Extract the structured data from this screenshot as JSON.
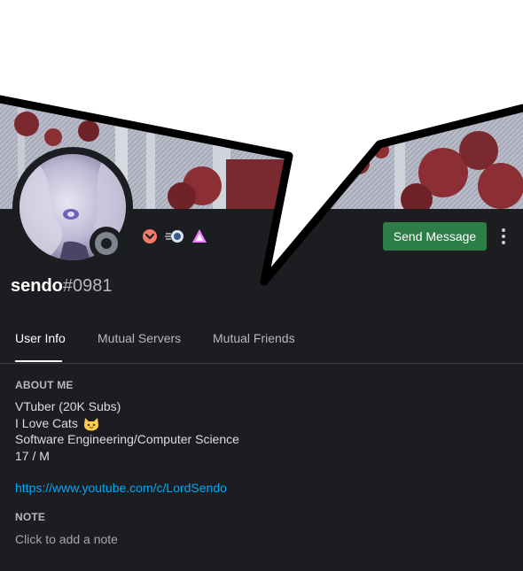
{
  "profile": {
    "username": "sendo",
    "discriminator": "#0981",
    "status": "offline"
  },
  "actions": {
    "send_message": "Send Message",
    "more": "more-options"
  },
  "badges": [
    "nitro-boost-badge-icon",
    "hypesquad-speed-icon",
    "hypesquad-brilliance-icon"
  ],
  "tabs": [
    {
      "label": "User Info",
      "active": true
    },
    {
      "label": "Mutual Servers",
      "active": false
    },
    {
      "label": "Mutual Friends",
      "active": false
    }
  ],
  "about_me": {
    "title": "ABOUT ME",
    "lines": [
      "VTuber (20K Subs)",
      "I Love Cats",
      "Software Engineering/Computer Science",
      "17 / M"
    ],
    "link": "https://www.youtube.com/c/LordSendo"
  },
  "note": {
    "title": "NOTE",
    "placeholder": "Click to add a note"
  },
  "colors": {
    "card_bg": "#1c1d21",
    "send_button": "#2d7d46",
    "link": "#00a8fc",
    "banner_red": "#7a2a2e"
  }
}
